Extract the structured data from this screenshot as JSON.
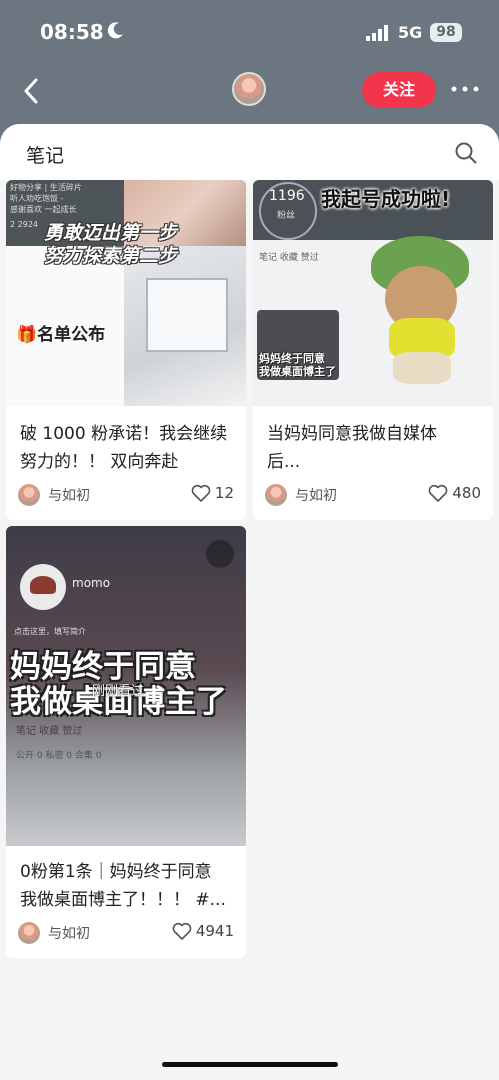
{
  "status_bar": {
    "time": "08:58",
    "network": "5G",
    "battery": "98"
  },
  "header": {
    "follow_label": "关注"
  },
  "sheet": {
    "title": "笔记"
  },
  "cards": [
    {
      "title_line1": "破 1000 粉承诺！我会继续",
      "title_line2": "努力的！！ 双向奔赴",
      "author": "与如初",
      "likes": "12",
      "image_text": {
        "caption1": "勇敢迈出第一步",
        "caption2": "努力探索第二步",
        "list_label": "名单公布",
        "strip_line1": "好物分享 | 生活碎片",
        "strip_line2": "听人劝吃饱饭 -",
        "strip_line3": "感谢喜欢 一起成长",
        "nums": "2   2924"
      }
    },
    {
      "title_line1": "当妈妈同意我做自媒体",
      "title_line2": "后...",
      "author": "与如初",
      "likes": "480",
      "image_text": {
        "headline": "我起号成功啦!",
        "fans_num": "1196",
        "fans_label": "粉丝",
        "tabs": "笔记   收藏   赞过",
        "mini_caption1": "妈妈终于同意",
        "mini_caption2": "我做桌面博主了"
      }
    },
    {
      "title_line1": "0粉第1条｜妈妈终于同意",
      "title_line2": "我做桌面博主了！！！ #...",
      "author": "与如初",
      "likes": "4941",
      "image_text": {
        "username": "momo",
        "intro": "点击这里，填写简介",
        "caption1": "妈妈终于同意",
        "caption2": "我做桌面博主了",
        "seen_label": "刚刚看过",
        "tabs": "笔记    收藏    赞过",
        "tabs2": "公开 0    私密 0    合集 0"
      }
    }
  ],
  "colors": {
    "accent": "#f3354c",
    "header_bg": "#6b7680"
  }
}
